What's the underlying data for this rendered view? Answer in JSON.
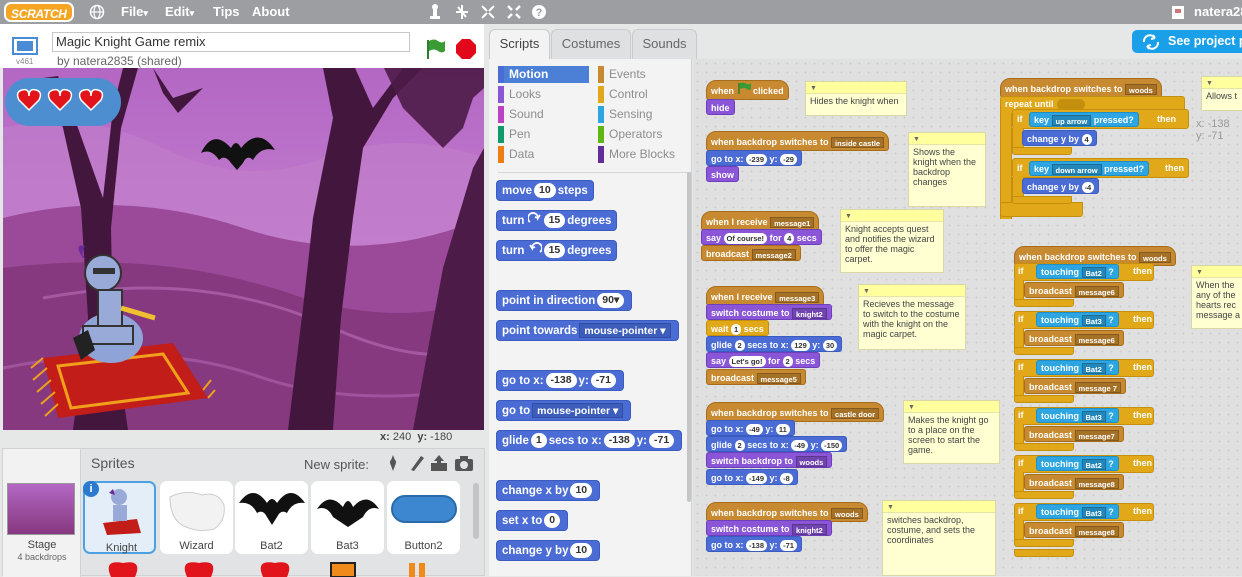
{
  "menubar": {
    "logo": "SCRATCH",
    "file": "File",
    "edit": "Edit",
    "tips": "Tips",
    "about": "About",
    "caret": "▾",
    "username": "natera28"
  },
  "project": {
    "title": "Magic Knight Game remix",
    "author": "by natera2835 (shared)",
    "version": "v461"
  },
  "stage": {
    "mouse_x_label": "x:",
    "mouse_x": "240",
    "mouse_y_label": "y:",
    "mouse_y": "-180"
  },
  "sprites": {
    "header": "Sprites",
    "new_sprite": "New sprite:",
    "stage_label": "Stage",
    "stage_sub": "4 backdrops",
    "items": [
      {
        "name": "Knight",
        "selected": true
      },
      {
        "name": "Wizard"
      },
      {
        "name": "Bat2"
      },
      {
        "name": "Bat3"
      },
      {
        "name": "Button2"
      }
    ]
  },
  "tabs": [
    "Scripts",
    "Costumes",
    "Sounds"
  ],
  "share": "See project p",
  "categories": [
    {
      "name": "Motion",
      "color": "#4a6cd4",
      "active": true
    },
    {
      "name": "Events",
      "color": "#c88a30"
    },
    {
      "name": "Looks",
      "color": "#8a55d7"
    },
    {
      "name": "Control",
      "color": "#e1a91a"
    },
    {
      "name": "Sound",
      "color": "#bb42c3"
    },
    {
      "name": "Sensing",
      "color": "#2ca5e2"
    },
    {
      "name": "Pen",
      "color": "#0e9a6c"
    },
    {
      "name": "Operators",
      "color": "#5cb712"
    },
    {
      "name": "Data",
      "color": "#ee7d16"
    },
    {
      "name": "More Blocks",
      "color": "#632d99"
    }
  ],
  "palette": {
    "move": {
      "a": "move",
      "n": "10",
      "b": "steps"
    },
    "turn_right": {
      "a": "turn",
      "n": "15",
      "b": "degrees",
      "icon": "rotate-right-icon"
    },
    "turn_left": {
      "a": "turn",
      "n": "15",
      "b": "degrees",
      "icon": "rotate-left-icon"
    },
    "point_dir": {
      "a": "point in direction",
      "n": "90▾"
    },
    "point_towards": {
      "a": "point towards",
      "d": "mouse-pointer ▾"
    },
    "goto_xy": {
      "a": "go to x:",
      "x": "-138",
      "b": "y:",
      "y": "-71"
    },
    "goto": {
      "a": "go to",
      "d": "mouse-pointer ▾"
    },
    "glide": {
      "a": "glide",
      "n": "1",
      "b": "secs to x:",
      "x": "-138",
      "c": "y:",
      "y": "-71"
    },
    "change_x": {
      "a": "change x by",
      "n": "10"
    },
    "set_x": {
      "a": "set x to",
      "n": "0"
    },
    "change_y": {
      "a": "change y by",
      "n": "10"
    }
  },
  "scripts": {
    "s1": {
      "hat_a": "when",
      "hat_b": "clicked",
      "hide": "hide",
      "note": "Hides the knight when"
    },
    "s2": {
      "hat": "when backdrop switches to",
      "hat_d": "inside castle",
      "go_a": "go to x:",
      "go_x": "-239",
      "go_b": "y:",
      "go_y": "-29",
      "show": "show",
      "note": "Shows the knight when the backdrop changes"
    },
    "s3": {
      "hat": "when I receive",
      "hat_d": "message1",
      "say_a": "say",
      "say_v": "Of course!",
      "say_b": "for",
      "say_n": "4",
      "say_c": "secs",
      "bc": "broadcast",
      "bc_d": "message2",
      "note": "Knight accepts quest and notifies the wizard to offer the magic carpet."
    },
    "s4": {
      "hat": "when I receive",
      "hat_d": "message3",
      "sw": "switch costume to",
      "sw_d": "knight2",
      "wait_a": "wait",
      "wait_n": "1",
      "wait_b": "secs",
      "gl_a": "glide",
      "gl_n": "2",
      "gl_b": "secs to x:",
      "gl_x": "129",
      "gl_c": "y:",
      "gl_y": "30",
      "say_a": "say",
      "say_v": "Let's go!",
      "say_b": "for",
      "say_n": "2",
      "say_c": "secs",
      "bc": "broadcast",
      "bc_d": "message5",
      "note": "Recieves the message to switch to the costume with the knight on the magic carpet."
    },
    "s5": {
      "hat": "when backdrop switches to",
      "hat_d": "castle door",
      "go_a": "go to x:",
      "go_x": "-49",
      "go_b": "y:",
      "go_y": "11",
      "gl_a": "glide",
      "gl_n": "2",
      "gl_b": "secs to x:",
      "gl_x": "-49",
      "gl_c": "y:",
      "gl_y": "-150",
      "swb": "switch backdrop to",
      "swb_d": "woods",
      "go2_a": "go to x:",
      "go2_x": "-149",
      "go2_b": "y:",
      "go2_y": "-8",
      "note": "Makes the knight go to a place on the screen to start the game."
    },
    "s6": {
      "hat": "when backdrop switches to",
      "hat_d": "woods",
      "sw": "switch costume to",
      "sw_d": "knight2",
      "go_a": "go to x:",
      "go_x": "-138",
      "go_b": "y:",
      "go_y": "-71",
      "note": "switches backdrop, costume, and sets the coordinates"
    },
    "s7": {
      "hat": "when backdrop switches to",
      "hat_d": "woods",
      "repeat": "repeat until",
      "if1": "if",
      "key1": "key",
      "key1_d": "up arrow",
      "pressed1": "pressed?",
      "then1": "then",
      "cy1": "change y by",
      "cy1_n": "4",
      "if2": "if",
      "key2": "key",
      "key2_d": "down arrow",
      "pressed2": "pressed?",
      "then2": "then",
      "cy2": "change y by",
      "cy2_n": "-4",
      "note": "Allows t"
    },
    "s8": {
      "hat": "when backdrop switches to",
      "hat_d": "woods",
      "note": "When the any of the hearts rec message a",
      "ifs": [
        {
          "if": "if",
          "touching": "touching",
          "target": "Bat2",
          "q": "?",
          "then": "then",
          "bc": "broadcast",
          "msg": "message6"
        },
        {
          "if": "if",
          "touching": "touching",
          "target": "Bat3",
          "q": "?",
          "then": "then",
          "bc": "broadcast",
          "msg": "message6"
        },
        {
          "if": "if",
          "touching": "touching",
          "target": "Bat2",
          "q": "?",
          "then": "then",
          "bc": "broadcast",
          "msg": "message 7"
        },
        {
          "if": "if",
          "touching": "touching",
          "target": "Bat3",
          "q": "?",
          "then": "then",
          "bc": "broadcast",
          "msg": "message7"
        },
        {
          "if": "if",
          "touching": "touching",
          "target": "Bat2",
          "q": "?",
          "then": "then",
          "bc": "broadcast",
          "msg": "message8"
        },
        {
          "if": "if",
          "touching": "touching",
          "target": "Bat3",
          "q": "?",
          "then": "then",
          "bc": "broadcast",
          "msg": "message8"
        }
      ]
    },
    "xy": {
      "x_label": "x:",
      "x": "-138",
      "y_label": "y:",
      "y": "-71"
    }
  }
}
